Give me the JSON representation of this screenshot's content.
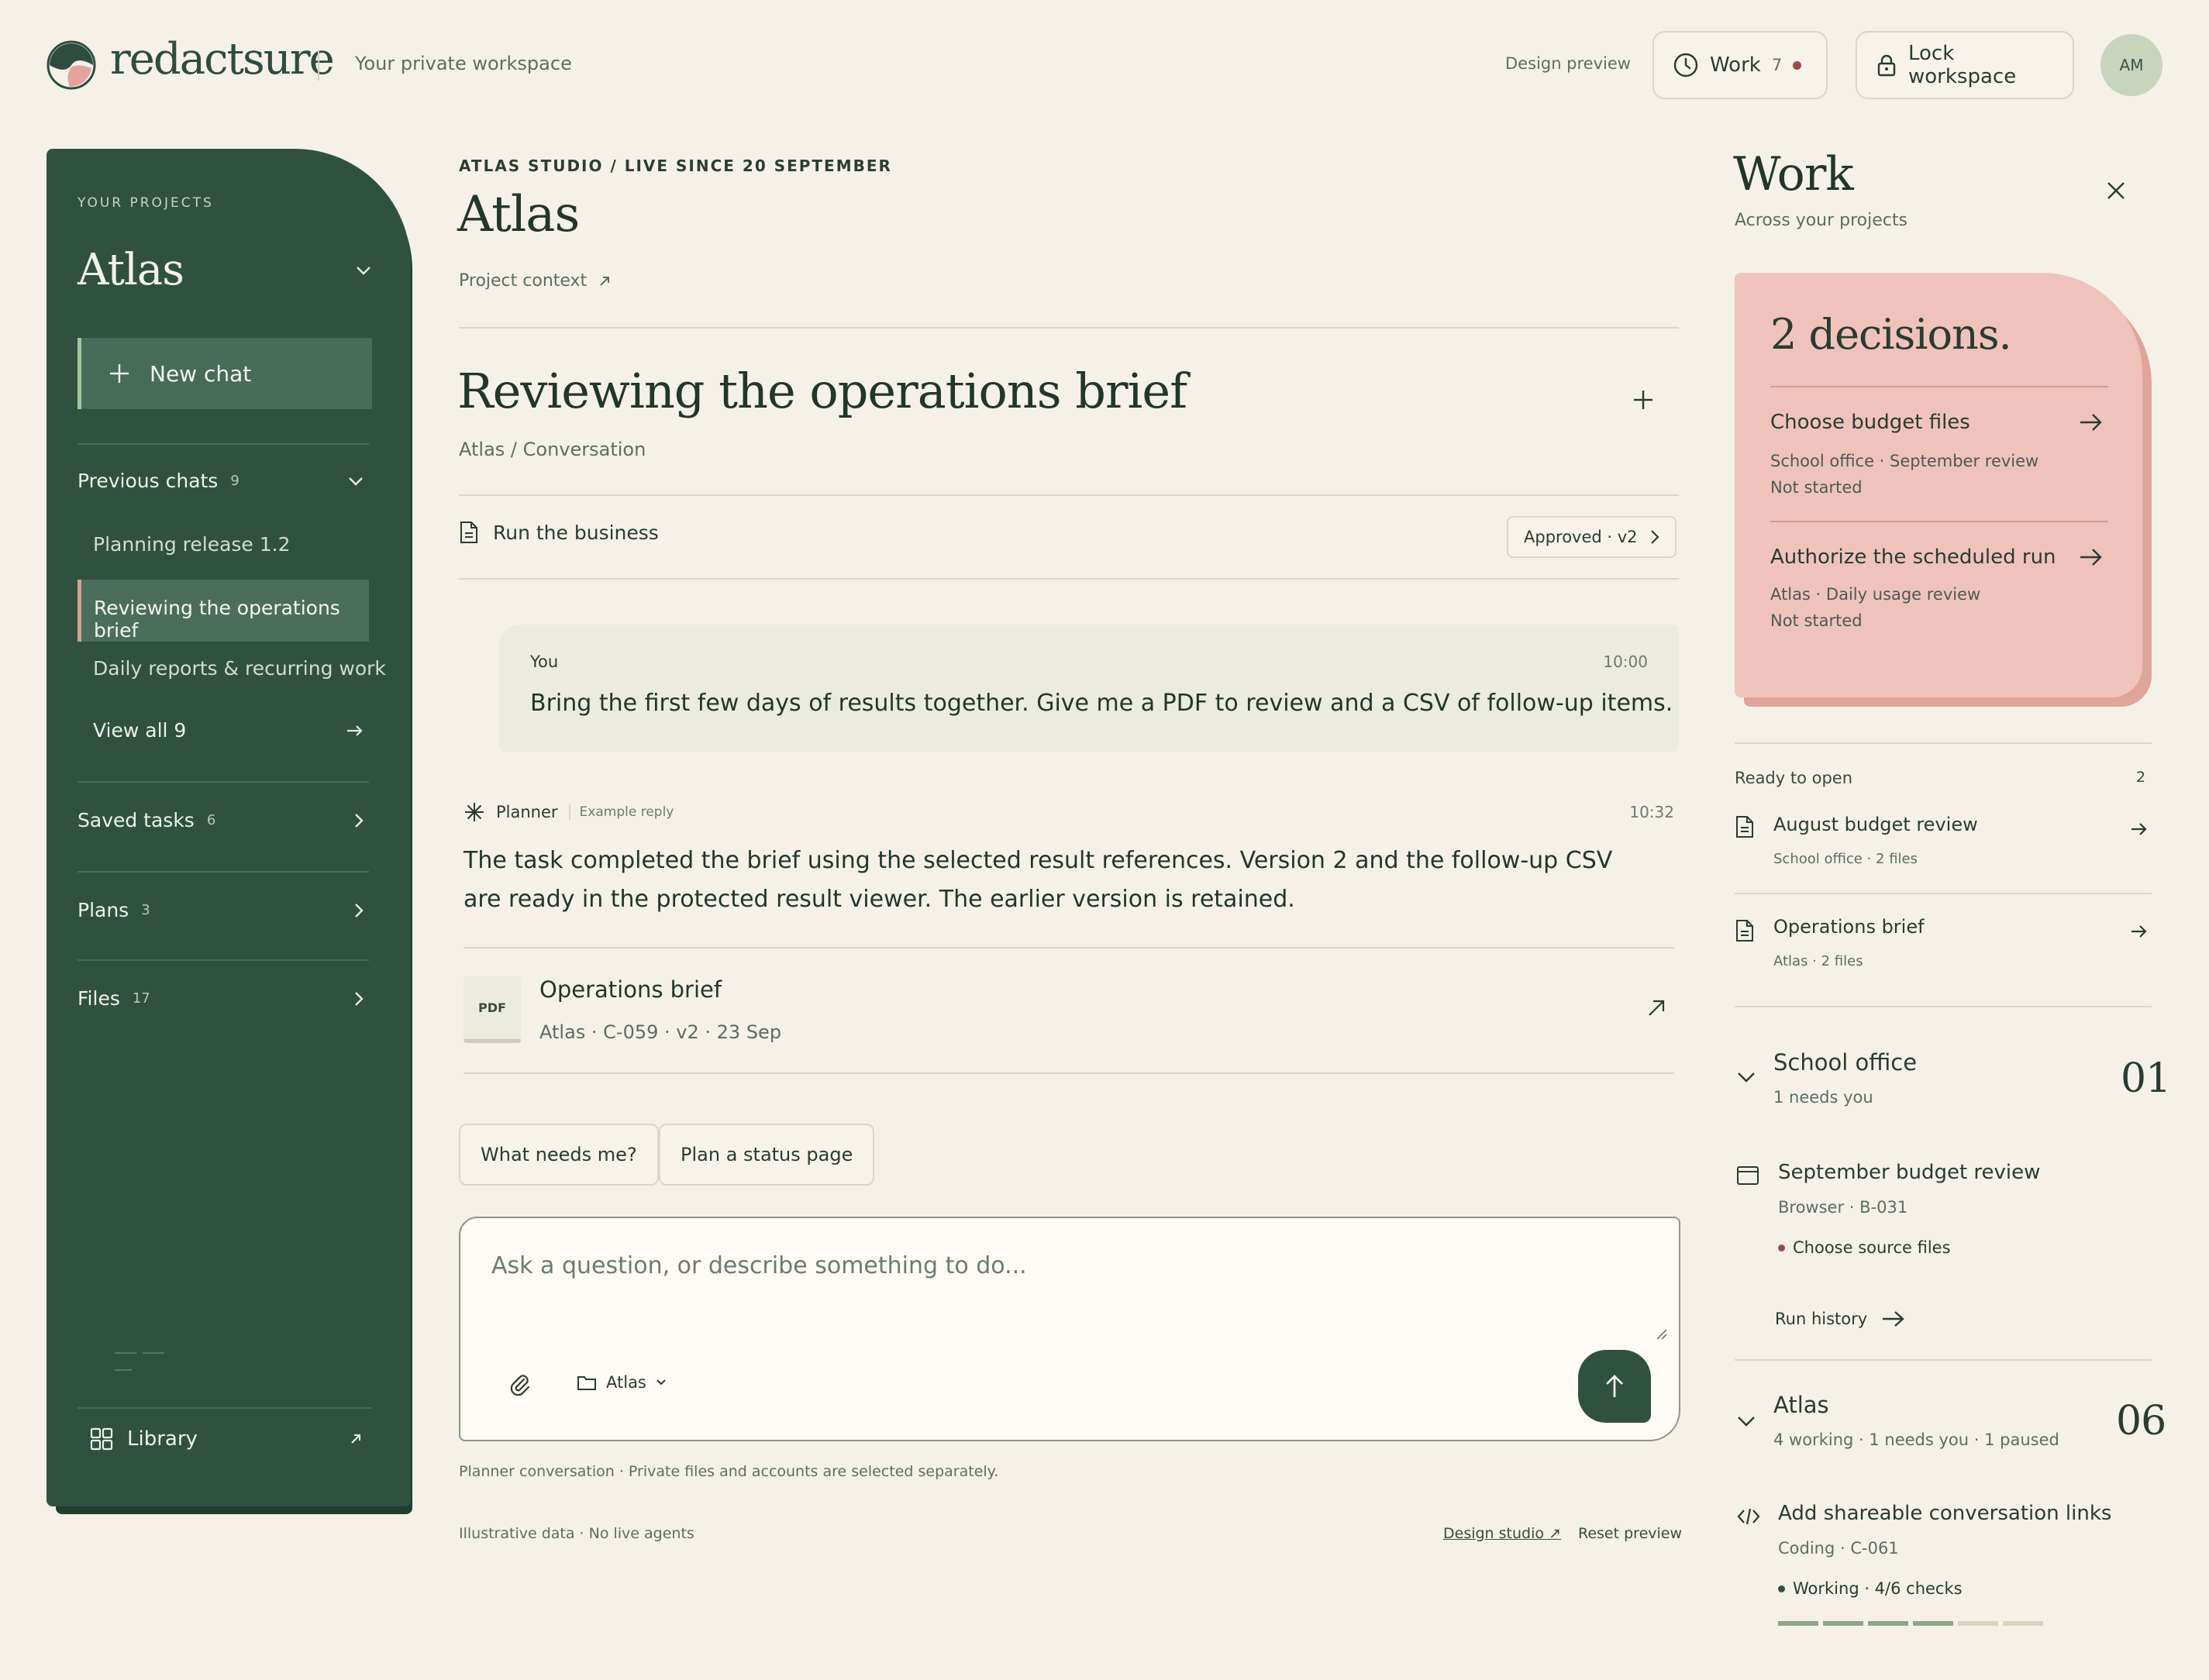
{
  "header": {
    "brand": "redactsure",
    "tagline": "Your private workspace",
    "design_preview": "Design preview",
    "work_label": "Work",
    "work_count": "7",
    "lock_label": "Lock workspace",
    "avatar_initials": "AM"
  },
  "sidebar": {
    "section_label": "YOUR PROJECTS",
    "project_name": "Atlas",
    "new_chat": "New chat",
    "previous_chats": {
      "label": "Previous chats",
      "count": "9"
    },
    "chats": [
      {
        "label": "Planning release 1.2",
        "active": false
      },
      {
        "label": "Reviewing the operations brief",
        "active": true
      },
      {
        "label": "Daily reports & recurring work",
        "active": false
      }
    ],
    "view_all": "View all 9",
    "sections": [
      {
        "label": "Saved tasks",
        "count": "6"
      },
      {
        "label": "Plans",
        "count": "3"
      },
      {
        "label": "Files",
        "count": "17"
      }
    ],
    "library": "Library"
  },
  "main": {
    "breadcrumb": "ATLAS STUDIO / LIVE SINCE 20 SEPTEMBER",
    "title": "Atlas",
    "project_context": "Project context",
    "conversation_title": "Reviewing the operations brief",
    "conversation_path": "Atlas / Conversation",
    "linked_doc": "Run the business",
    "approved_pill": "Approved · v2",
    "user_message": {
      "author": "You",
      "time": "10:00",
      "text": "Bring the first few days of results together. Give me a PDF to review and a CSV of follow-up items."
    },
    "planner_message": {
      "author": "Planner",
      "tag": "Example reply",
      "time": "10:32",
      "text": "The task completed the brief using the selected result references. Version 2 and the follow-up CSV are ready in the protected result viewer. The earlier version is retained."
    },
    "attachment": {
      "kind": "PDF",
      "title": "Operations brief",
      "meta": "Atlas · C-059 · v2 · 23 Sep"
    },
    "suggestions": [
      "What needs me?",
      "Plan a status page"
    ],
    "composer": {
      "placeholder": "Ask a question, or describe something to do...",
      "scope": "Atlas"
    },
    "footnote": "Planner conversation · Private files and accounts are selected separately.",
    "illustrative": "Illustrative data · No live agents",
    "design_studio": "Design studio ↗",
    "reset_preview": "Reset preview"
  },
  "work_panel": {
    "title": "Work",
    "subtitle": "Across your projects",
    "decisions": {
      "title": "2 decisions.",
      "items": [
        {
          "title": "Choose budget files",
          "meta": "School office · September review",
          "status": "Not started"
        },
        {
          "title": "Authorize the scheduled run",
          "meta": "Atlas · Daily usage review",
          "status": "Not started"
        }
      ]
    },
    "ready": {
      "label": "Ready to open",
      "count": "2",
      "items": [
        {
          "title": "August budget review",
          "meta": "School office · 2 files"
        },
        {
          "title": "Operations brief",
          "meta": "Atlas · 2 files"
        }
      ]
    },
    "groups": [
      {
        "title": "School office",
        "subtitle": "1 needs you",
        "number": "01",
        "task": {
          "title": "September budget review",
          "meta": "Browser · B-031",
          "status": "Choose source files",
          "status_color": "#9c4a48",
          "link": "Run history"
        }
      },
      {
        "title": "Atlas",
        "subtitle": "4 working · 1 needs you · 1 paused",
        "number": "06",
        "task": {
          "title": "Add shareable conversation links",
          "meta": "Coding · C-061",
          "status": "Working · 4/6 checks",
          "status_color": "#30513f",
          "progress": 0.667
        }
      }
    ]
  },
  "colors": {
    "background": "#f5f1e8",
    "sidebar": "#30513f",
    "accent_pink": "#efc3bb",
    "alert_red": "#9c4a48"
  }
}
